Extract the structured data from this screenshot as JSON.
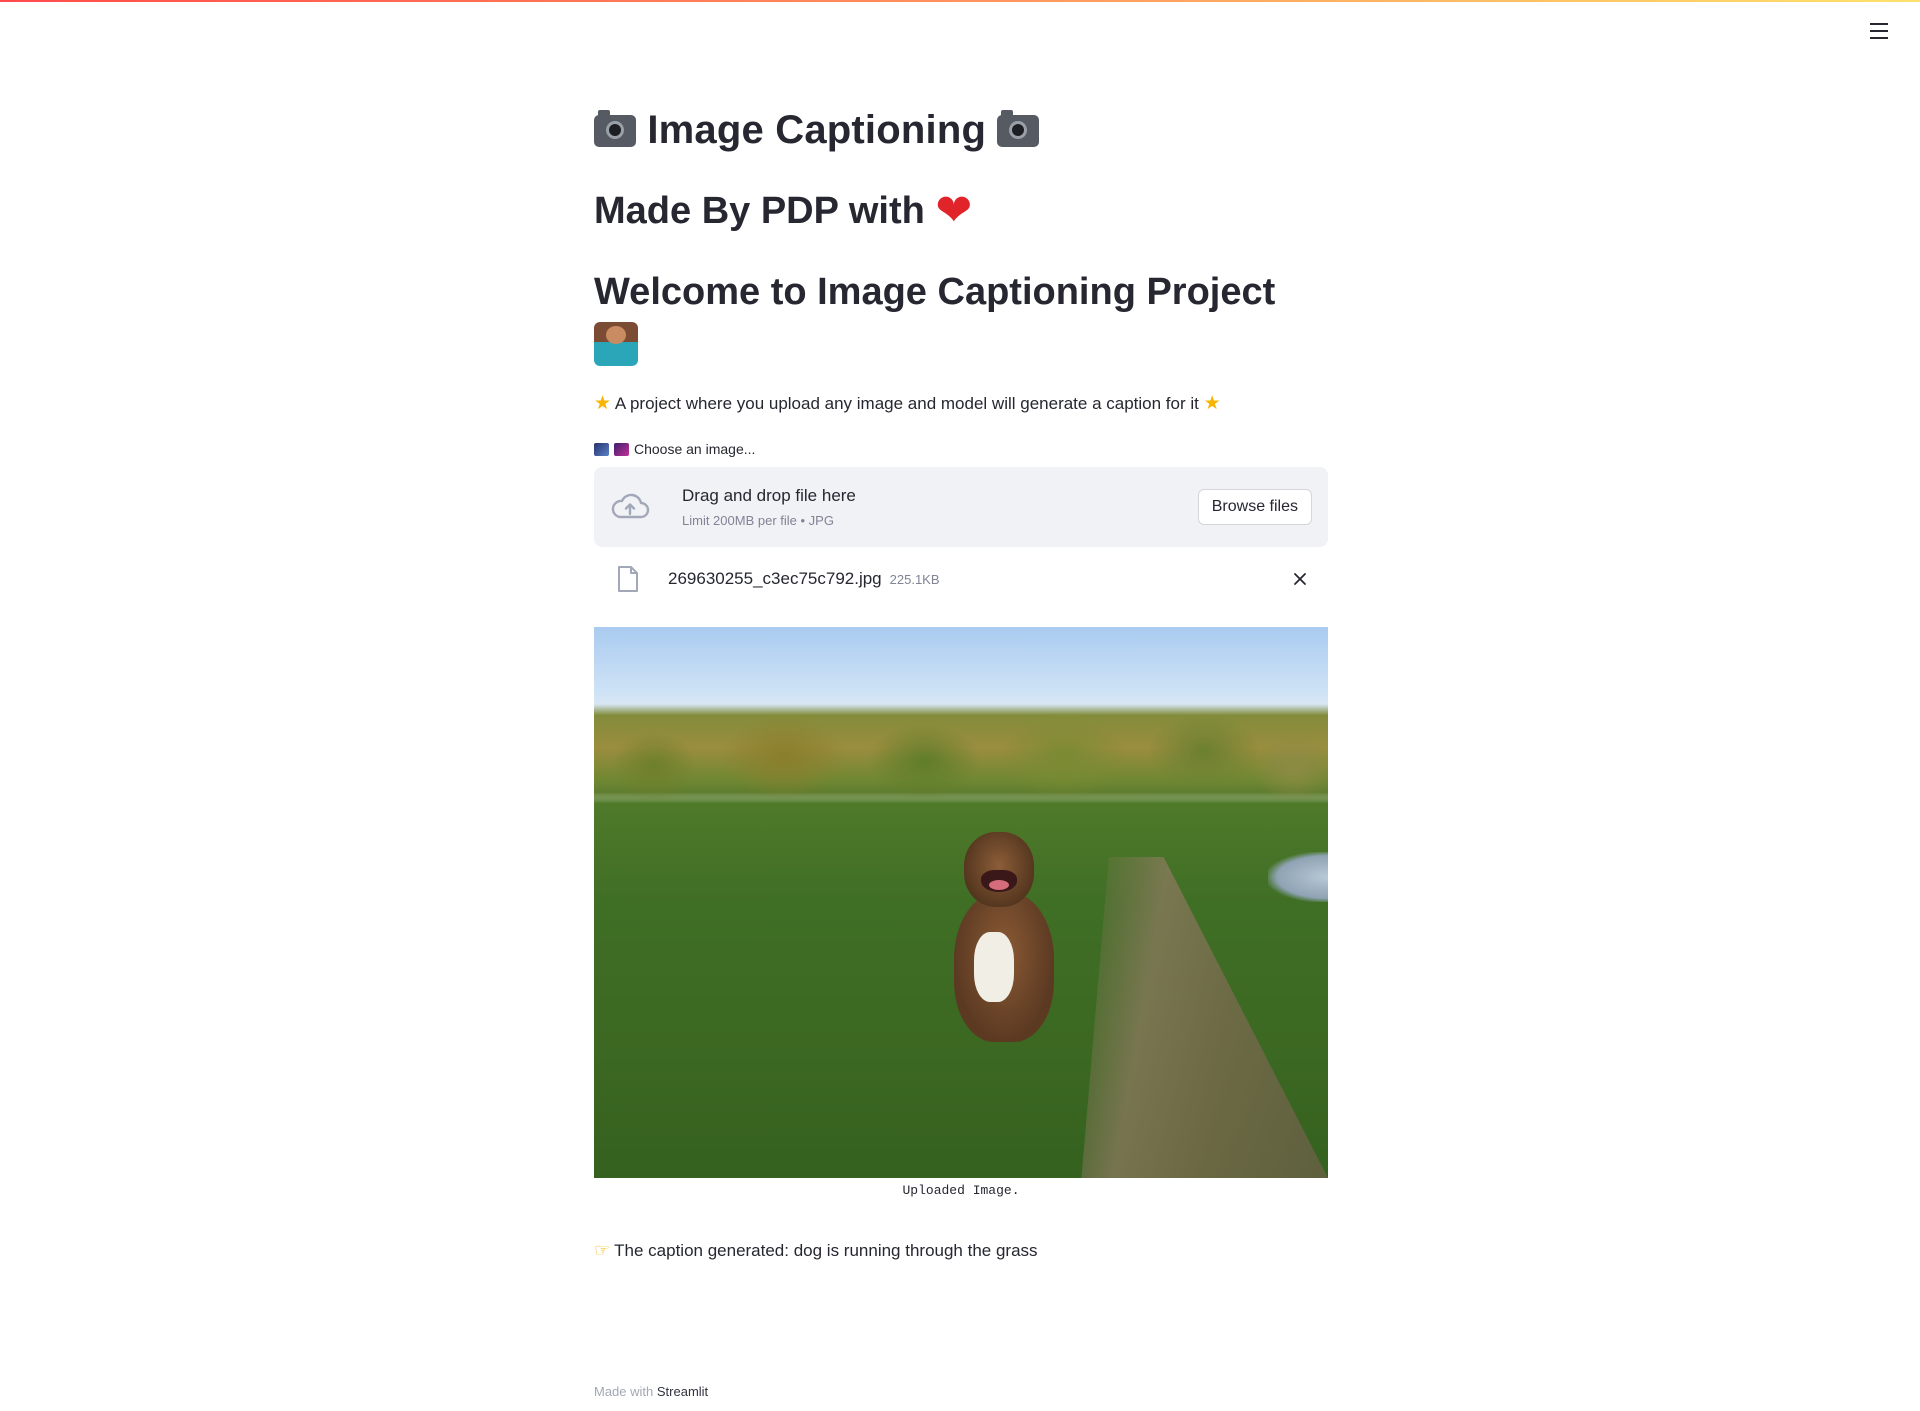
{
  "app": {
    "title": "Image Captioning",
    "subtitle": "Made By PDP with",
    "welcome": "Welcome to Image Captioning Project",
    "description": "A project where you upload any image and model will generate a caption for it"
  },
  "icons": {
    "camera": "camera-icon",
    "heart": "heart-icon",
    "coder": "technologist-icon",
    "star": "star-icon",
    "cloud_upload": "cloud-upload-icon",
    "file": "file-icon",
    "close": "close-icon",
    "pointing": "pointing-hand-icon",
    "menu": "hamburger-menu-icon"
  },
  "uploader": {
    "label": "Choose an image...",
    "drop_title": "Drag and drop file here",
    "drop_sub": "Limit 200MB per file • JPG",
    "browse_label": "Browse files",
    "file_name": "269630255_c3ec75c792.jpg",
    "file_size": "225.1KB"
  },
  "image": {
    "caption": "Uploaded Image."
  },
  "result": {
    "text": "The caption generated: dog is running through the grass"
  },
  "footer": {
    "prefix": "Made with",
    "brand": "Streamlit"
  },
  "colors": {
    "accent": "#ff4b4b",
    "dropzone_bg": "#f0f2f6",
    "text": "#262730",
    "muted": "#808495"
  }
}
